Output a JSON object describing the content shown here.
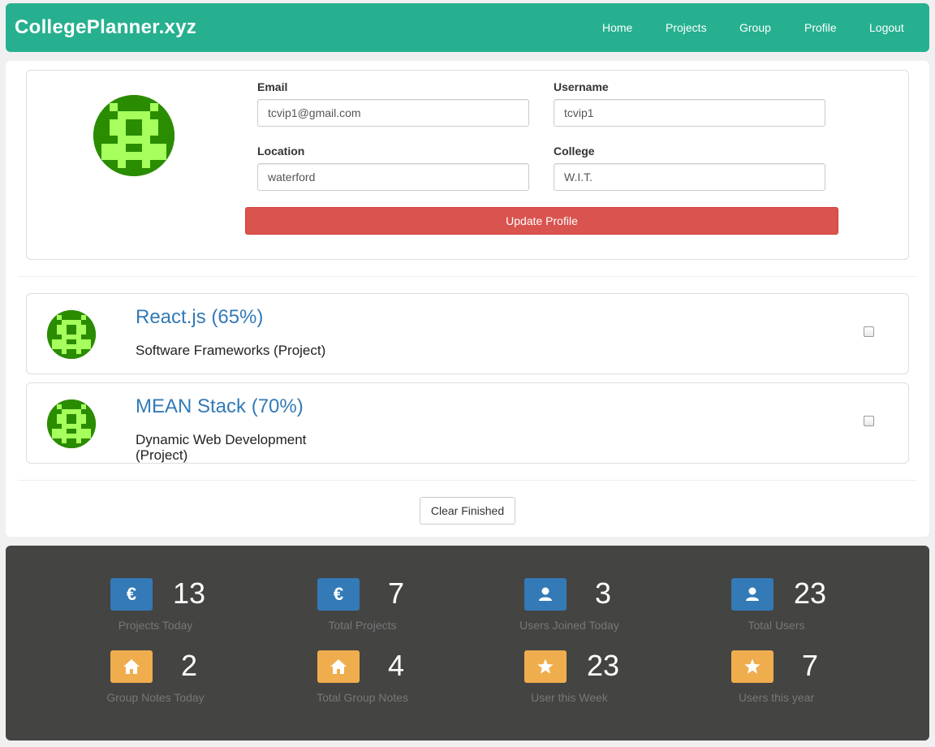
{
  "nav": {
    "brand": "CollegePlanner.xyz",
    "links": [
      "Home",
      "Projects",
      "Group",
      "Profile",
      "Logout"
    ]
  },
  "profile": {
    "email_label": "Email",
    "email_value": "tcvip1@gmail.com",
    "username_label": "Username",
    "username_value": "tcvip1",
    "location_label": "Location",
    "location_value": "waterford",
    "college_label": "College",
    "college_value": "W.I.T.",
    "update_button": "Update Profile"
  },
  "projects": [
    {
      "title": "React.js (65%)",
      "subtitle": "Software Frameworks (Project)",
      "checked": false
    },
    {
      "title": "MEAN Stack (70%)",
      "subtitle": "Dynamic Web Development (Project)",
      "checked": false
    }
  ],
  "clear_button": "Clear Finished",
  "stats": [
    {
      "value": "13",
      "label": "Projects Today",
      "icon": "euro-icon",
      "color": "#337ab7"
    },
    {
      "value": "7",
      "label": "Total Projects",
      "icon": "euro-icon",
      "color": "#337ab7"
    },
    {
      "value": "3",
      "label": "Users Joined Today",
      "icon": "user-icon",
      "color": "#337ab7"
    },
    {
      "value": "23",
      "label": "Total Users",
      "icon": "user-icon",
      "color": "#337ab7"
    },
    {
      "value": "2",
      "label": "Group Notes Today",
      "icon": "home-icon",
      "color": "#f0ad4e"
    },
    {
      "value": "4",
      "label": "Total Group Notes",
      "icon": "home-icon",
      "color": "#f0ad4e"
    },
    {
      "value": "23",
      "label": "User this Week",
      "icon": "star-icon",
      "color": "#f0ad4e"
    },
    {
      "value": "7",
      "label": "Users this year",
      "icon": "star-icon",
      "color": "#f0ad4e"
    }
  ],
  "colors": {
    "navbar": "#26b08f",
    "danger": "#d9534f",
    "link": "#337ab7",
    "footer": "#444443",
    "avatar_dark": "#2a8c00",
    "avatar_light": "#a6ff5c"
  }
}
